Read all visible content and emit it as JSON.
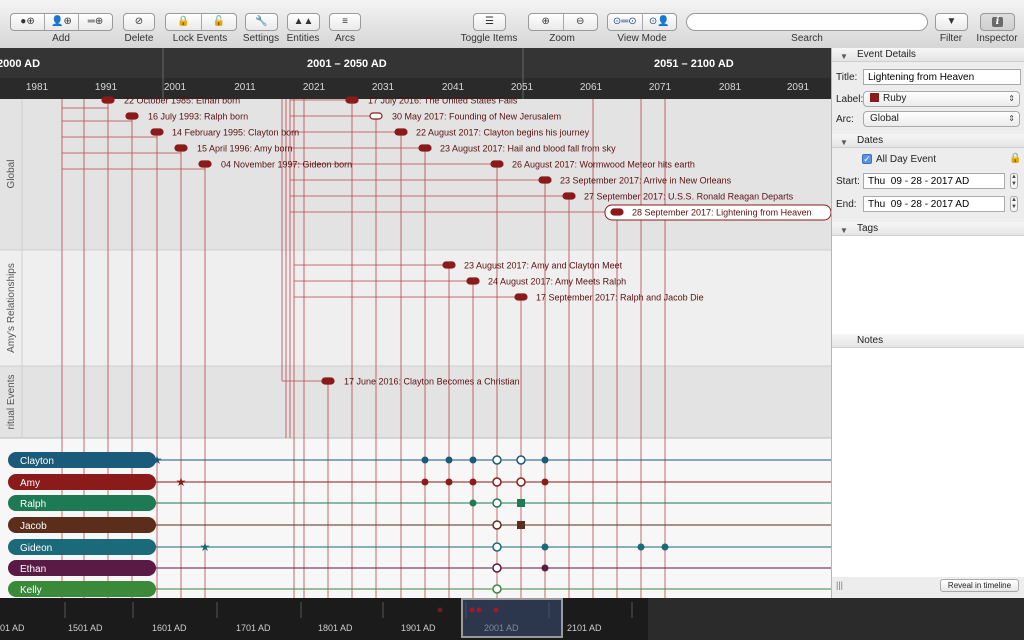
{
  "toolbar": {
    "items": [
      {
        "label": "Add"
      },
      {
        "label": "Delete"
      },
      {
        "label": "Lock Events"
      },
      {
        "label": "Settings"
      },
      {
        "label": "Entities"
      },
      {
        "label": "Arcs"
      },
      {
        "label": "Toggle Items"
      },
      {
        "label": "Zoom"
      },
      {
        "label": "View Mode"
      },
      {
        "label": "Search"
      },
      {
        "label": "Filter"
      },
      {
        "label": "Inspector"
      }
    ],
    "search_placeholder": ""
  },
  "ruler": {
    "ranges": [
      {
        "label": "2000 AD"
      },
      {
        "label": "2001 – 2050 AD"
      },
      {
        "label": "2051 – 2100 AD"
      }
    ],
    "years": [
      "1981",
      "1991",
      "2001",
      "2011",
      "2021",
      "2031",
      "2041",
      "2051",
      "2061",
      "2071",
      "2081",
      "2091"
    ]
  },
  "lanes": [
    {
      "label": "Global"
    },
    {
      "label": "Amy's Relationships"
    },
    {
      "label": "ritual Events"
    }
  ],
  "events": [
    {
      "label": "22 October 1985: Ethan born"
    },
    {
      "label": "16 July 1993: Ralph born"
    },
    {
      "label": "14 February 1995: Clayton born"
    },
    {
      "label": "15 April 1996: Amy born"
    },
    {
      "label": "04 November 1997: Gideon born"
    },
    {
      "label": "17 July 2016: The United States Falls"
    },
    {
      "label": "30 May 2017: Founding of New Jerusalem"
    },
    {
      "label": "22 August 2017: Clayton begins his journey"
    },
    {
      "label": "23 August 2017: Hail and blood fall from sky"
    },
    {
      "label": "26 August 2017: Wormwood Meteor hits earth"
    },
    {
      "label": "23 September 2017: Arrive in New Orleans"
    },
    {
      "label": "27 September 2017: U.S.S. Ronald Reagan Departs"
    },
    {
      "label": "28 September 2017: Lightening from Heaven"
    },
    {
      "label": "23 August 2017: Amy and Clayton Meet"
    },
    {
      "label": "24 August 2017: Amy Meets Ralph"
    },
    {
      "label": "17 September 2017: Ralph and Jacob Die"
    },
    {
      "label": "17 June 2016: Clayton Becomes a Christian"
    }
  ],
  "entities": [
    {
      "name": "Clayton",
      "color": "#1a5a7a"
    },
    {
      "name": "Amy",
      "color": "#8b1a1a"
    },
    {
      "name": "Ralph",
      "color": "#1e7a55"
    },
    {
      "name": "Jacob",
      "color": "#5a2e1a"
    },
    {
      "name": "Gideon",
      "color": "#1a6a7a"
    },
    {
      "name": "Ethan",
      "color": "#5a1a46"
    },
    {
      "name": "Kelly",
      "color": "#3a8a3a"
    }
  ],
  "overview": {
    "centuries": [
      "01 AD",
      "1501 AD",
      "1601 AD",
      "1701 AD",
      "1801 AD",
      "1901 AD",
      "2001 AD",
      "2101 AD"
    ]
  },
  "inspector": {
    "event_details_header": "Event Details",
    "title_label": "Title:",
    "title_value": "Lightening from Heaven",
    "label_label": "Label:",
    "label_value": "Ruby",
    "label_color": "#8b1a1a",
    "arc_label": "Arc:",
    "arc_value": "Global",
    "dates_header": "Dates",
    "all_day_label": "All Day Event",
    "start_label": "Start:",
    "start_value": "Thu  09 - 28 - 2017 AD",
    "end_label": "End:",
    "end_value": "Thu  09 - 28 - 2017 AD",
    "tags_header": "Tags",
    "notes_header": "Notes",
    "reveal_button": "Reveal in timeline"
  },
  "colors": {
    "accent": "#8b1a1a",
    "toolbar_bg": "#e0e0e0",
    "ruler_bg": "#3a3a3a"
  }
}
